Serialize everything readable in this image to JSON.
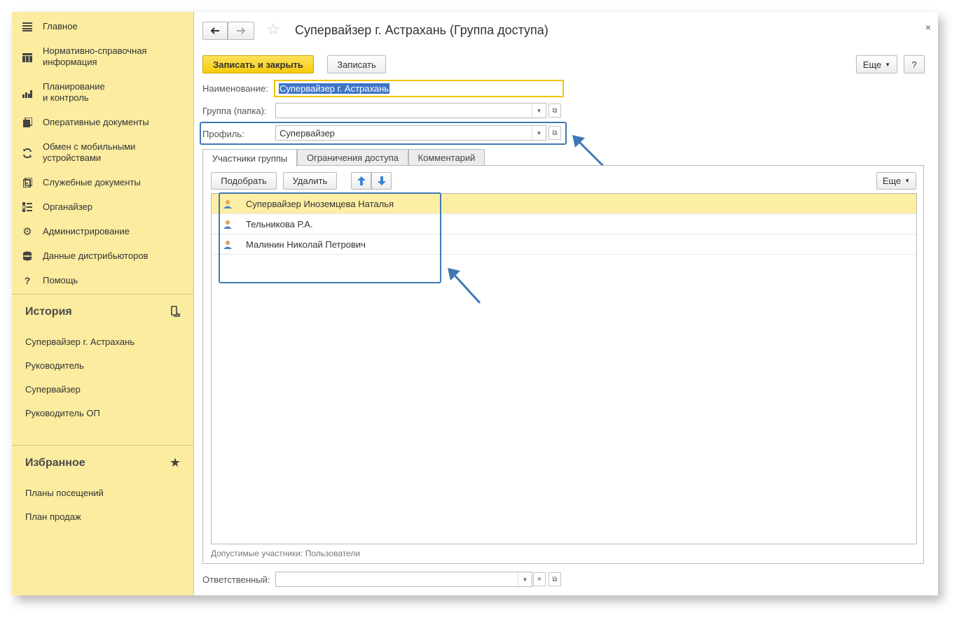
{
  "sidebar": {
    "nav": [
      {
        "icon": "menu-icon",
        "label": "Главное"
      },
      {
        "icon": "catalog-icon",
        "label": "Нормативно-справочная\nинформация"
      },
      {
        "icon": "chart-icon",
        "label": "Планирование\nи контроль"
      },
      {
        "icon": "documents-icon",
        "label": "Оперативные документы"
      },
      {
        "icon": "sync-icon",
        "label": "Обмен с мобильными\nустройствами"
      },
      {
        "icon": "service-docs-icon",
        "label": "Служебные документы"
      },
      {
        "icon": "organizer-icon",
        "label": "Органайзер"
      },
      {
        "icon": "gear-icon",
        "label": "Администрирование"
      },
      {
        "icon": "database-icon",
        "label": "Данные дистрибьюторов"
      },
      {
        "icon": "help-icon",
        "label": "Помощь"
      }
    ],
    "history": {
      "title": "История",
      "items": [
        "Супервайзер г. Астрахань",
        "Руководитель",
        "Супервайзер",
        "Руководитель ОП"
      ]
    },
    "favorites": {
      "title": "Избранное",
      "items": [
        "Планы посещений",
        "План продаж"
      ]
    }
  },
  "form": {
    "title": "Супервайзер г. Астрахань (Группа доступа)",
    "close": "×",
    "buttons": {
      "save_close": "Записать и закрыть",
      "save": "Записать",
      "more": "Еще",
      "help": "?"
    },
    "fields": {
      "name_label": "Наименование:",
      "name_value": "Супервайзер г. Астрахань",
      "group_label": "Группа (папка):",
      "group_value": "",
      "profile_label": "Профиль:",
      "profile_value": "Супервайзер",
      "responsible_label": "Ответственный:",
      "responsible_value": ""
    },
    "tabs": [
      "Участники группы",
      "Ограничения доступа",
      "Комментарий"
    ],
    "panel": {
      "pick": "Подобрать",
      "delete": "Удалить",
      "more": "Еще",
      "members": [
        "Супервайзер Иноземцева Наталья",
        "Тельникова Р.А.",
        "Малинин Николай Петрович"
      ],
      "allowed": "Допустимые участники: Пользователи"
    }
  },
  "colors": {
    "sidebar_bg": "#fbeca0",
    "primary_button": "#f6cb0c",
    "selected_row": "#fcefa4",
    "annotation": "#3f78b5"
  }
}
